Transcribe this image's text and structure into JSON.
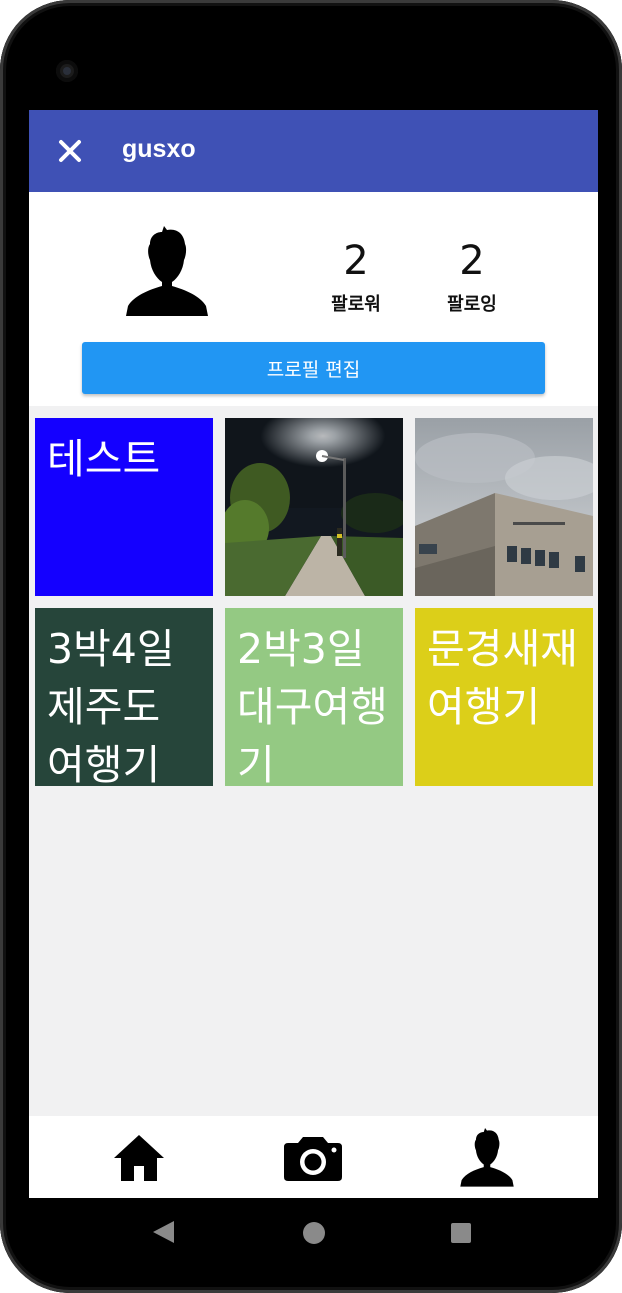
{
  "appbar": {
    "title": "gusxo",
    "close_icon": "close-icon",
    "bg_color": "#3f51b5"
  },
  "profile": {
    "avatar_icon": "person-silhouette-icon",
    "followers": {
      "count": "2",
      "label": "팔로워"
    },
    "following": {
      "count": "2",
      "label": "팔로잉"
    },
    "edit_button": {
      "label": "프로필 편집",
      "color": "#2196f3"
    }
  },
  "posts": [
    {
      "type": "text",
      "text": "테스트",
      "color": "#1400ff"
    },
    {
      "type": "photo",
      "subject": "night-street-photo"
    },
    {
      "type": "photo",
      "subject": "building-photo"
    },
    {
      "type": "text",
      "text": "3박4일 제주도 여행기",
      "color": "#26453a"
    },
    {
      "type": "text",
      "text": "2박3일 대구여행기",
      "color": "#94c983"
    },
    {
      "type": "text",
      "text": "문경새재 여행기",
      "color": "#dccf19"
    }
  ],
  "bottom_nav": [
    {
      "icon": "home-icon"
    },
    {
      "icon": "camera-icon"
    },
    {
      "icon": "profile-icon"
    }
  ],
  "system_nav": [
    {
      "icon": "back-icon"
    },
    {
      "icon": "home-circle-icon"
    },
    {
      "icon": "recents-icon"
    }
  ]
}
